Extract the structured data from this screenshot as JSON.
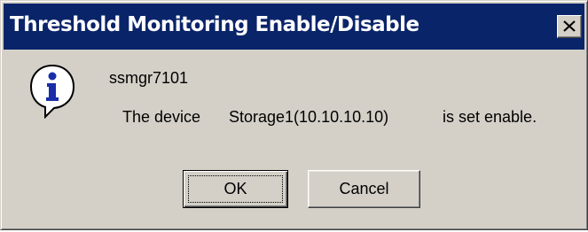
{
  "dialog": {
    "title": "Threshold Monitoring Enable/Disable",
    "close_glyph": "×",
    "icon": "information-icon",
    "message_id": "ssmgr7101",
    "message_part_1": "The device",
    "message_part_2": "Storage1(10.10.10.10)",
    "message_part_3": "is set enable."
  },
  "buttons": {
    "ok_label": "OK",
    "cancel_label": "Cancel"
  },
  "colors": {
    "titlebar": "#0a246a",
    "dialog_face": "#d4d0c8",
    "icon_blue": "#1a2ea8"
  }
}
